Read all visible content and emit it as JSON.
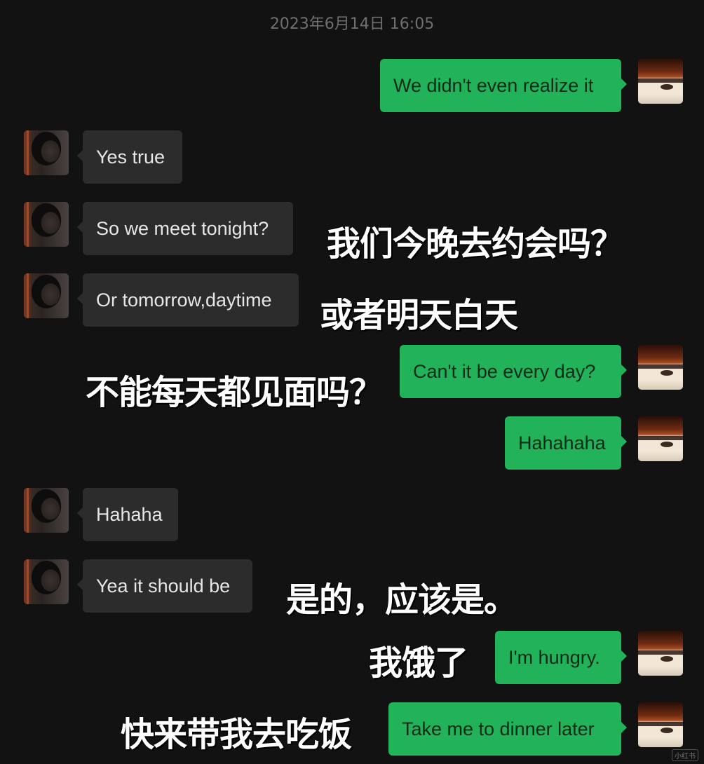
{
  "timestamp": "2023年6月14日 16:05",
  "messages": [
    {
      "text": "We didn't even realize it"
    },
    {
      "text": "Yes true"
    },
    {
      "text": "So we meet tonight?"
    },
    {
      "text": "Or tomorrow,daytime"
    },
    {
      "text": "Can't it be every day?"
    },
    {
      "text": "Hahahaha"
    },
    {
      "text": "Hahaha"
    },
    {
      "text": "Yea it should be"
    },
    {
      "text": "I'm hungry."
    },
    {
      "text": "Take me to dinner later"
    }
  ],
  "captions": [
    "我们今晚去约会吗？",
    "或者明天白天",
    "不能每天都见面吗？",
    "是的，应该是。",
    "我饿了",
    "快来带我去吃饭"
  ],
  "watermark": "小红书"
}
